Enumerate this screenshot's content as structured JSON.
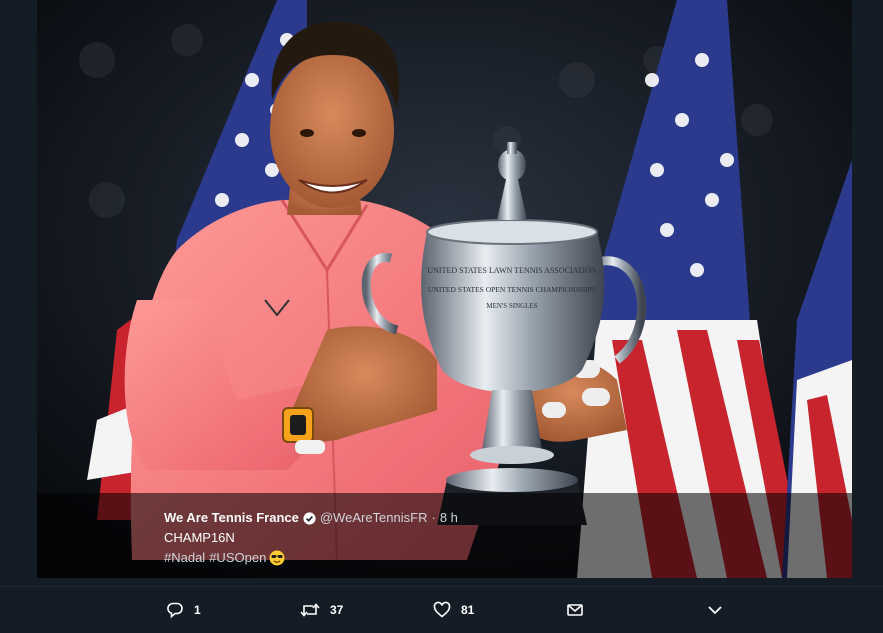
{
  "tweet": {
    "display_name": "We Are Tennis France",
    "handle": "@WeAreTennisFR",
    "separator": "·",
    "time": "8 h",
    "text": "CHAMP16N",
    "hashtags": [
      "#Nadal",
      "#USOpen"
    ]
  },
  "trophy": {
    "engraving_line1": "UNITED STATES LAWN TENNIS ASSOCIATION",
    "engraving_line2": "UNITED STATES OPEN TENNIS CHAMPIONSHIPS",
    "engraving_line3": "MEN'S SINGLES"
  },
  "actions": {
    "reply_count": "1",
    "retweet_count": "37",
    "like_count": "81"
  },
  "icons": {
    "verified": "verified-badge-icon",
    "emoji": "cool-sunglasses-emoji-icon",
    "reply": "reply-icon",
    "retweet": "retweet-icon",
    "like": "heart-icon",
    "message": "envelope-icon",
    "more": "chevron-down-icon"
  },
  "colors": {
    "background": "#141d26",
    "shirt": "#f37b7f",
    "flag_red": "#c8242e",
    "flag_blue": "#2b3a8c"
  }
}
